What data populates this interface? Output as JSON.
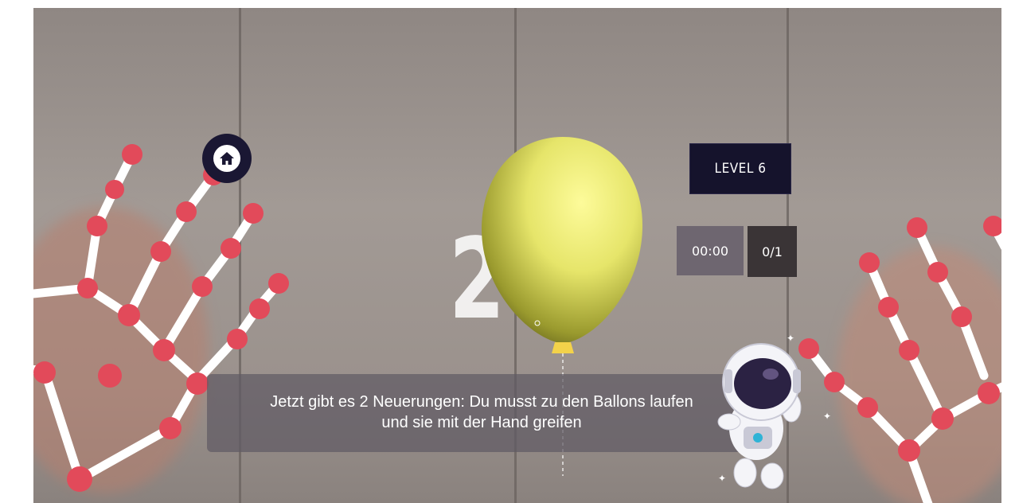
{
  "game": {
    "level_label": "LEVEL 6",
    "timer": "00:00",
    "balloon_count": "0/1",
    "countdown": "2",
    "instruction_line1": "Jetzt gibt es 2 Neuerungen: Du musst zu den Ballons laufen",
    "instruction_line2": "und sie mit der Hand greifen"
  },
  "icons": {
    "home": "home-icon",
    "balloon": "balloon-icon",
    "mascot": "astronaut-icon"
  },
  "colors": {
    "joint": "#e24a5a",
    "bone": "#ffffff",
    "panel_dark": "#15132c",
    "balloon": "#e6e56a"
  }
}
